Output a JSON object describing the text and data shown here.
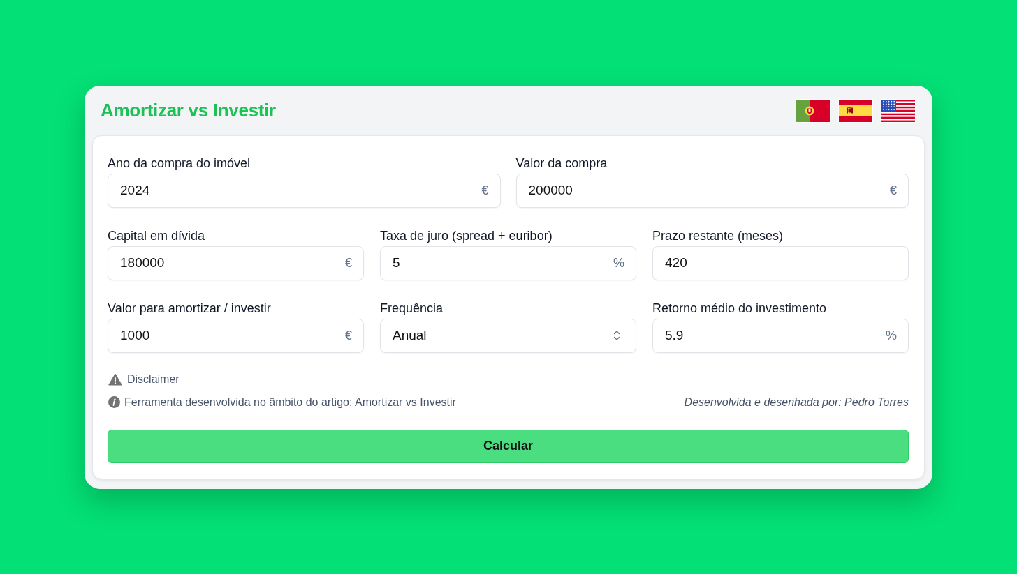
{
  "header": {
    "title": "Amortizar vs Investir"
  },
  "form": {
    "rows": [
      [
        {
          "label": "Ano da compra do imóvel",
          "kind": "input",
          "value": "2024",
          "suffix": "€"
        },
        {
          "label": "Valor da compra",
          "kind": "input",
          "value": "200000",
          "suffix": "€"
        }
      ],
      [
        {
          "label": "Capital em dívida",
          "kind": "input",
          "value": "180000",
          "suffix": "€"
        },
        {
          "label": "Taxa de juro (spread + euribor)",
          "kind": "input",
          "value": "5",
          "suffix": "%"
        },
        {
          "label": "Prazo restante (meses)",
          "kind": "input",
          "value": "420"
        }
      ],
      [
        {
          "label": "Valor para amortizar / investir",
          "kind": "input",
          "value": "1000",
          "suffix": "€"
        },
        {
          "label": "Frequência",
          "kind": "select",
          "value": "Anual"
        },
        {
          "label": "Retorno médio do investimento",
          "kind": "input",
          "value": "5.9",
          "suffix": "%"
        }
      ]
    ]
  },
  "disclaimer": "Disclaimer",
  "info": {
    "text": "Ferramenta desenvolvida no âmbito do artigo:",
    "link": "Amortizar vs Investir"
  },
  "credit": "Desenvolvida e desenhada por: Pedro Torres",
  "submit_button": "Calcular"
}
